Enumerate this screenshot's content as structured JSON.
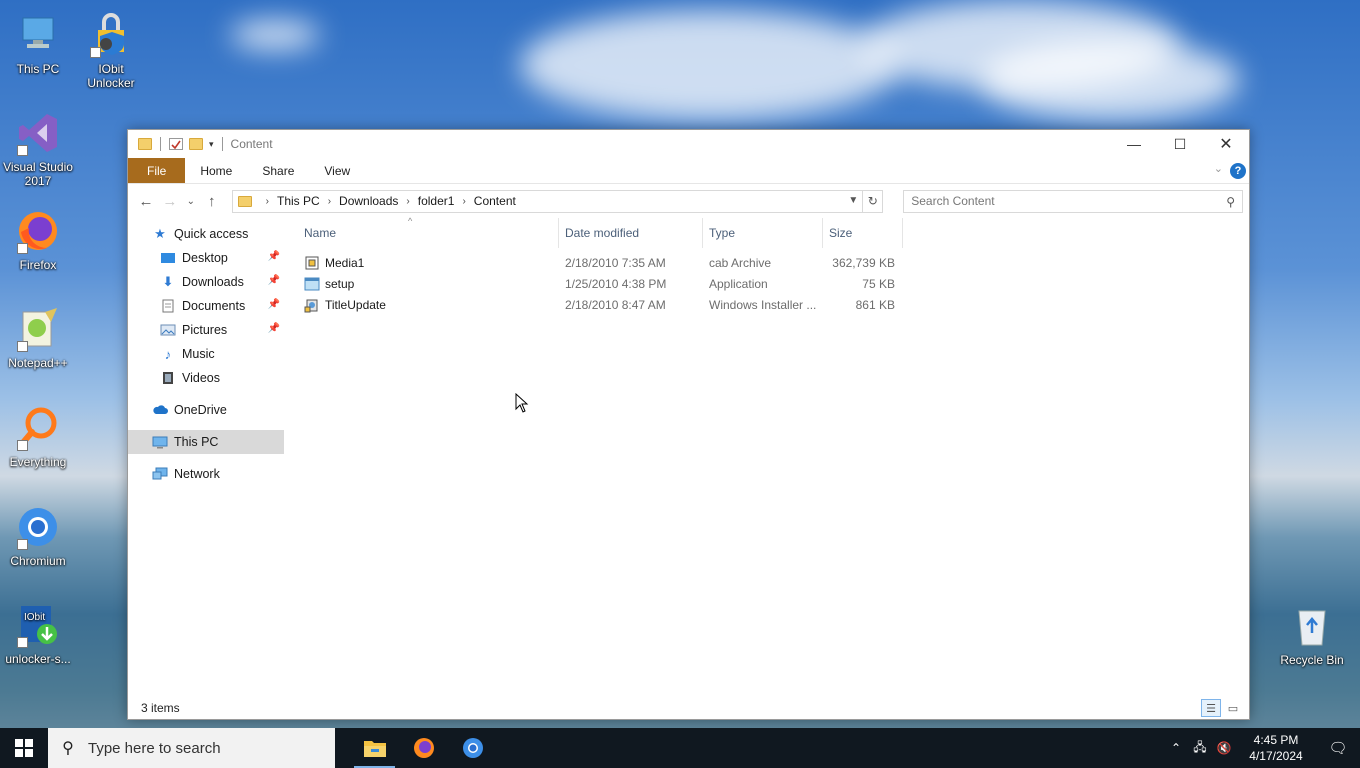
{
  "desktop": {
    "icons": [
      {
        "label": "This PC"
      },
      {
        "label": "IObit Unlocker"
      },
      {
        "label": "Visual Studio 2017"
      },
      {
        "label": "Firefox"
      },
      {
        "label": "Notepad++"
      },
      {
        "label": "Everything"
      },
      {
        "label": "Chromium"
      },
      {
        "label": "unlocker-s..."
      },
      {
        "label": "Recycle Bin"
      }
    ]
  },
  "window": {
    "title": "Content",
    "ribbon_tabs": [
      "File",
      "Home",
      "Share",
      "View"
    ],
    "help_label": "?",
    "breadcrumb": [
      "This PC",
      "Downloads",
      "folder1",
      "Content"
    ],
    "search_placeholder": "Search Content",
    "nav": {
      "quick_access": "Quick access",
      "quick_items": [
        "Desktop",
        "Downloads",
        "Documents",
        "Pictures",
        "Music",
        "Videos"
      ],
      "onedrive": "OneDrive",
      "this_pc": "This PC",
      "network": "Network"
    },
    "columns": [
      "Name",
      "Date modified",
      "Type",
      "Size"
    ],
    "files": [
      {
        "name": "Media1",
        "date": "2/18/2010 7:35 AM",
        "type": "cab Archive",
        "size": "362,739 KB"
      },
      {
        "name": "setup",
        "date": "1/25/2010 4:38 PM",
        "type": "Application",
        "size": "75 KB"
      },
      {
        "name": "TitleUpdate",
        "date": "2/18/2010 8:47 AM",
        "type": "Windows Installer ...",
        "size": "861 KB"
      }
    ],
    "status": "3 items"
  },
  "taskbar": {
    "search_placeholder": "Type here to search",
    "time": "4:45 PM",
    "date": "4/17/2024"
  },
  "colors": {
    "file_tab": "#a76b1d",
    "accent": "#1f73c9",
    "taskbar": "#101820"
  }
}
